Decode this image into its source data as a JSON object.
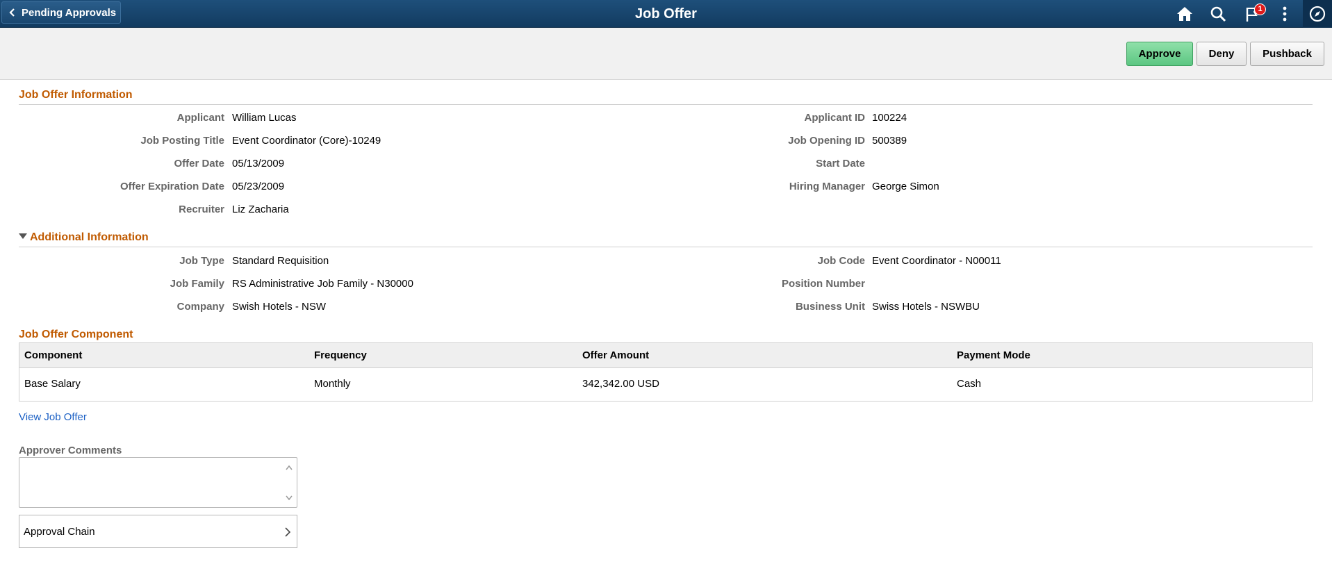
{
  "header": {
    "back_label": "Pending Approvals",
    "title": "Job Offer",
    "notification_count": "1",
    "icons": [
      "home-icon",
      "search-icon",
      "flag-icon",
      "more-options-icon",
      "compass-icon"
    ]
  },
  "actions": {
    "approve": "Approve",
    "deny": "Deny",
    "pushback": "Pushback"
  },
  "job_offer_info": {
    "title": "Job Offer Information",
    "left": [
      {
        "label": "Applicant",
        "value": "William Lucas"
      },
      {
        "label": "Job Posting Title",
        "value": "Event Coordinator (Core)-10249"
      },
      {
        "label": "Offer Date",
        "value": "05/13/2009"
      },
      {
        "label": "Offer Expiration Date",
        "value": "05/23/2009"
      },
      {
        "label": "Recruiter",
        "value": "Liz Zacharia"
      }
    ],
    "right": [
      {
        "label": "Applicant ID",
        "value": "100224"
      },
      {
        "label": "Job Opening ID",
        "value": "500389"
      },
      {
        "label": "Start Date",
        "value": ""
      },
      {
        "label": "Hiring Manager",
        "value": "George Simon"
      }
    ]
  },
  "additional_info": {
    "title": "Additional Information",
    "left": [
      {
        "label": "Job Type",
        "value": "Standard Requisition"
      },
      {
        "label": "Job Family",
        "value": "RS Administrative Job Family - N30000"
      },
      {
        "label": "Company",
        "value": "Swish Hotels - NSW"
      }
    ],
    "right": [
      {
        "label": "Job Code",
        "value": "Event Coordinator - N00011"
      },
      {
        "label": "Position Number",
        "value": ""
      },
      {
        "label": "Business Unit",
        "value": "Swiss Hotels - NSWBU"
      }
    ]
  },
  "component": {
    "title": "Job Offer Component",
    "columns": [
      "Component",
      "Frequency",
      "Offer Amount",
      "Payment Mode"
    ],
    "rows": [
      [
        "Base Salary",
        "Monthly",
        "342,342.00 USD",
        "Cash"
      ]
    ]
  },
  "view_link": "View Job Offer",
  "comments": {
    "label": "Approver Comments",
    "value": ""
  },
  "approval_chain": "Approval Chain",
  "colors": {
    "header_bg": "#1e4f7a",
    "section_title": "#c05a00",
    "approve_bg": "#6fd090",
    "link": "#1a5fc4"
  }
}
